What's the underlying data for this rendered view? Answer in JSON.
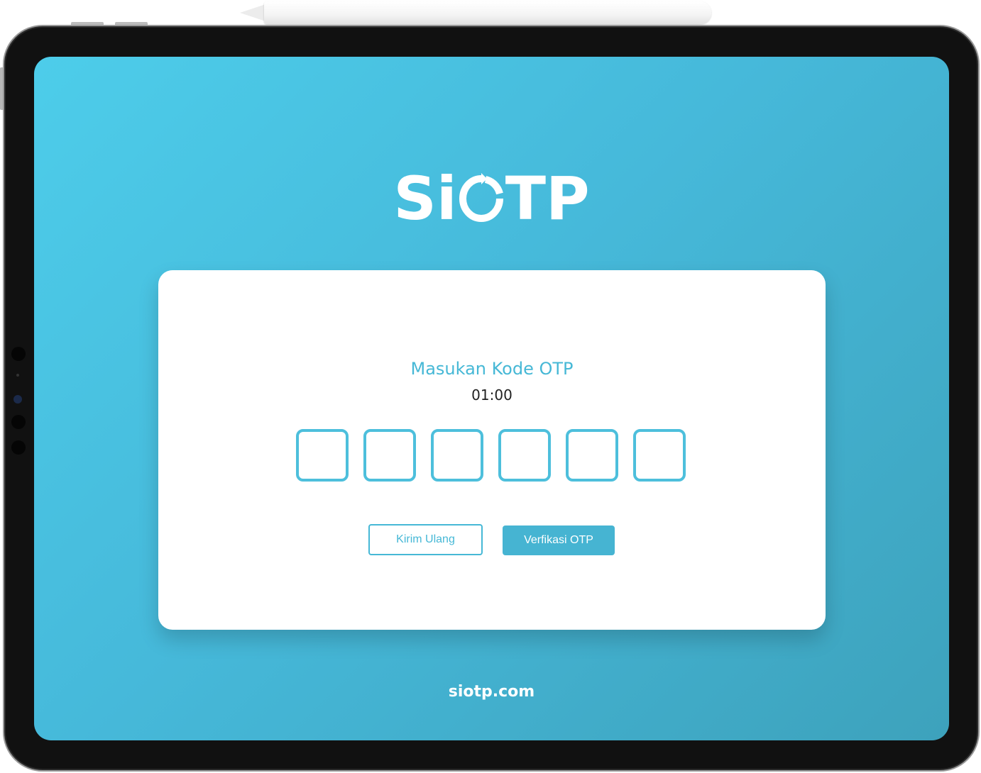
{
  "app": {
    "logo_text_left": "Si",
    "logo_text_right": "TP",
    "brand_colors": {
      "background_start": "#4dcdea",
      "background_end": "#3da2bc",
      "accent": "#46b8d6"
    }
  },
  "otp_card": {
    "title": "Masukan Kode OTP",
    "timer": "01:00",
    "digits": [
      "",
      "",
      "",
      "",
      "",
      ""
    ],
    "resend_label": "Kirim Ulang",
    "verify_label": "Verfikasi OTP"
  },
  "footer": {
    "site": "siotp.com"
  }
}
